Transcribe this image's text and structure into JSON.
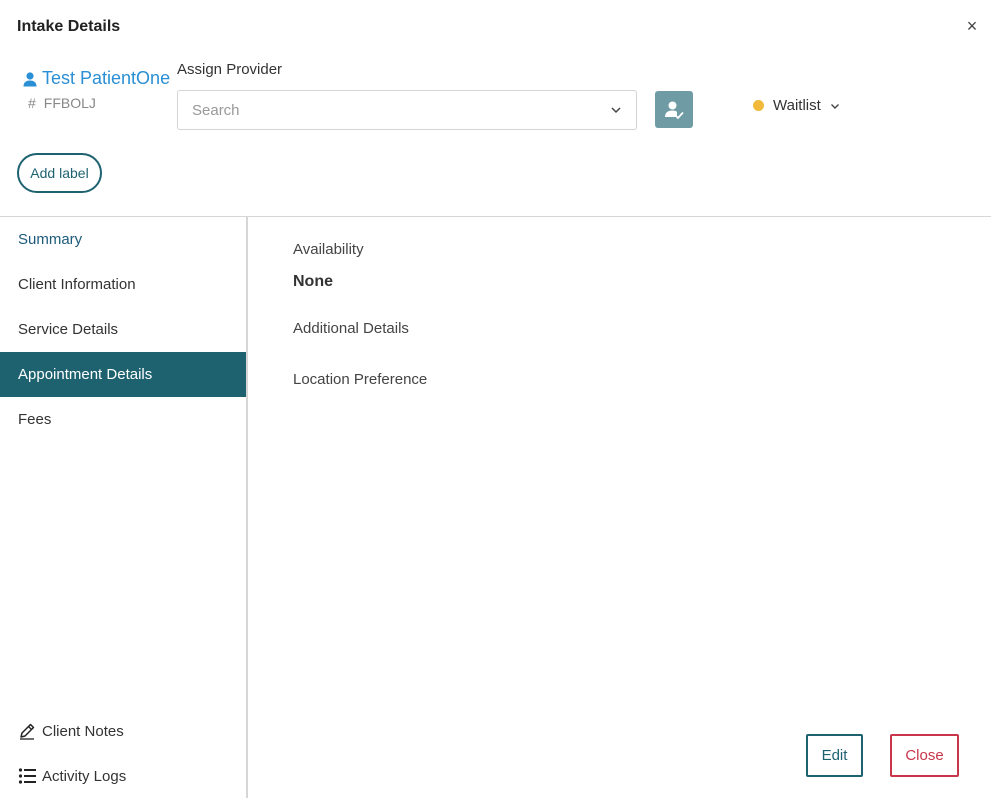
{
  "modal": {
    "title": "Intake Details",
    "close_icon": "close-icon"
  },
  "patient": {
    "name": "Test PatientOne",
    "id_prefix": "#",
    "id": "FFBOLJ"
  },
  "assign": {
    "label": "Assign Provider",
    "placeholder": "Search"
  },
  "status": {
    "label": "Waitlist",
    "color": "#f2b93b"
  },
  "add_label": "Add label",
  "nav": {
    "items": [
      {
        "label": "Summary"
      },
      {
        "label": "Client Information"
      },
      {
        "label": "Service Details"
      },
      {
        "label": "Appointment Details",
        "active": true
      },
      {
        "label": "Fees"
      }
    ],
    "client_notes": "Client Notes",
    "activity_logs": "Activity Logs"
  },
  "content": {
    "availability_label": "Availability",
    "availability_value": "None",
    "additional_details_label": "Additional Details",
    "location_preference_label": "Location Preference"
  },
  "footer": {
    "edit_label": "Edit",
    "close_label": "Close"
  },
  "colors": {
    "accent": "#1e6270",
    "link": "#2a8fd4",
    "danger": "#c9354a"
  }
}
